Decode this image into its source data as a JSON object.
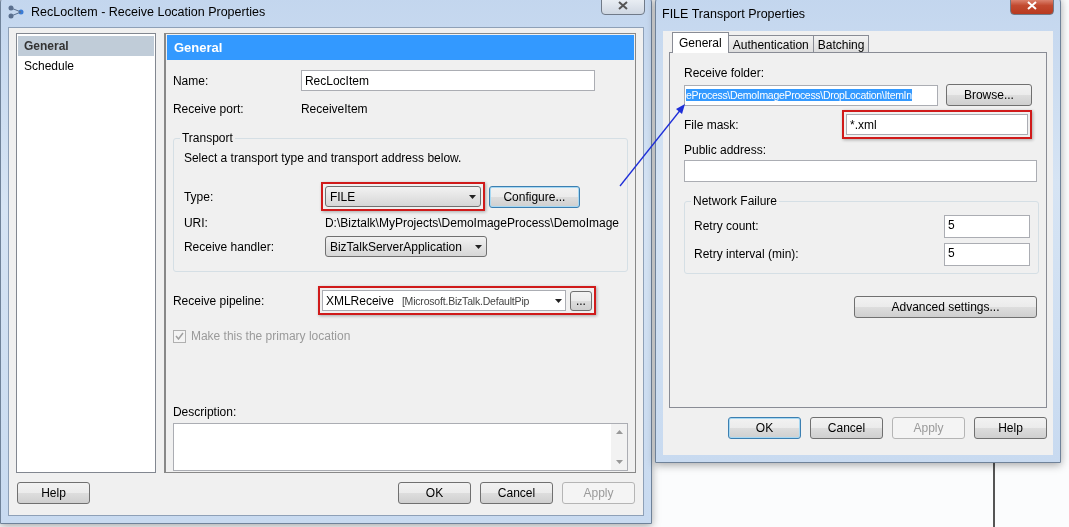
{
  "receive_location_dialog": {
    "title": "RecLocItem - Receive Location Properties",
    "nav": [
      {
        "label": "General",
        "selected": true
      },
      {
        "label": "Schedule",
        "selected": false
      }
    ],
    "header": "General",
    "fields": [
      {
        "label": "Name:",
        "value": "RecLocItem",
        "kind": "input"
      },
      {
        "label": "Receive port:",
        "value": "ReceiveItem",
        "kind": "text"
      }
    ],
    "transport": {
      "legend": "Transport",
      "hint": "Select a transport type and transport address below.",
      "type": {
        "label": "Type:",
        "value": "FILE",
        "highlighted": true
      },
      "configure_button": "Configure...",
      "uri": {
        "label": "URI:",
        "value": "D:\\Biztalk\\MyProjects\\DemoImageProcess\\DemoImage"
      },
      "handler": {
        "label": "Receive handler:",
        "value": "BizTalkServerApplication",
        "highlighted": false
      }
    },
    "pipeline": {
      "label": "Receive pipeline:",
      "value": "XMLReceive",
      "detail": "[Microsoft.BizTalk.DefaultPip",
      "highlighted": true,
      "browse_button": "..."
    },
    "primary": {
      "label": "Make this the primary location",
      "checked": true,
      "disabled": true
    },
    "description": {
      "label": "Description:"
    },
    "buttons": [
      {
        "label": "Help",
        "disabled": false
      },
      {
        "label": "OK",
        "disabled": false
      },
      {
        "label": "Cancel",
        "disabled": false
      },
      {
        "label": "Apply",
        "disabled": true
      }
    ]
  },
  "file_transport_dialog": {
    "title": "FILE Transport Properties",
    "tabs": [
      {
        "label": "General",
        "selected": true
      },
      {
        "label": "Authentication",
        "selected": false
      },
      {
        "label": "Batching",
        "selected": false
      }
    ],
    "receive_folder": {
      "label": "Receive folder:",
      "value": "eProcess\\DemoImageProcess\\DropLocation\\ItemIn",
      "text_selected": true,
      "browse_button": "Browse..."
    },
    "file_mask": {
      "label": "File mask:",
      "value": "*.xml",
      "highlighted": true
    },
    "public_address": {
      "label": "Public address:"
    },
    "network_failure": {
      "legend": "Network Failure",
      "fields": [
        {
          "label": "Retry count:",
          "value": "5"
        },
        {
          "label": "Retry interval (min):",
          "value": "5"
        }
      ]
    },
    "advanced_button": "Advanced settings...",
    "buttons": [
      {
        "label": "OK",
        "disabled": false,
        "default": true
      },
      {
        "label": "Cancel",
        "disabled": false,
        "default": false
      },
      {
        "label": "Apply",
        "disabled": true,
        "default": false
      },
      {
        "label": "Help",
        "disabled": false,
        "default": false
      }
    ]
  }
}
